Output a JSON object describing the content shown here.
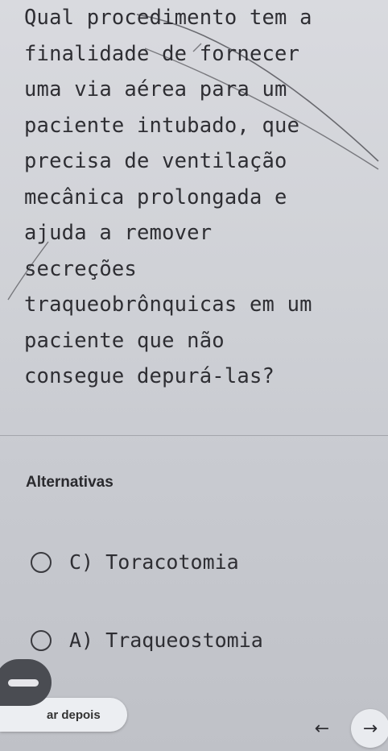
{
  "question": {
    "text": "Qual procedimento tem a\nfinalidade de fornecer\numa via aérea para um\npaciente intubado, que\nprecisa de ventilação\nmecânica prolongada e\najuda a remover\nsecreções\ntraqueobrônquicas em um\npaciente que não\nconsegue depurá-las?"
  },
  "alternatives": {
    "title": "Alternativas",
    "options": [
      {
        "label": "C) Toracotomia"
      },
      {
        "label": "A) Traqueostomia"
      }
    ]
  },
  "footer": {
    "save_later_label": "ar depois",
    "prev_icon": "arrow-left-icon",
    "next_icon": "arrow-right-icon"
  },
  "colors": {
    "background": "#cfd1d6",
    "text": "#2e2e33",
    "fab": "#4a4c52"
  }
}
